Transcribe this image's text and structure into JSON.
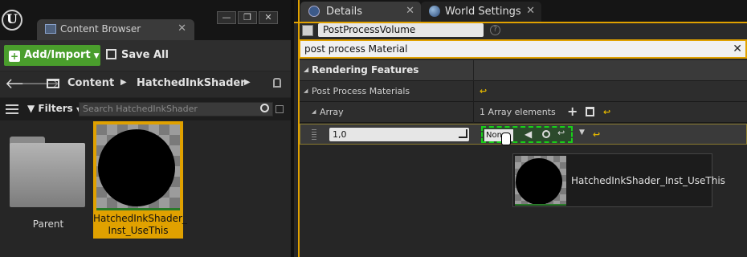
{
  "content_browser": {
    "tab_title": "Content Browser",
    "add_import_label": "Add/Import",
    "save_all_label": "Save All",
    "path": [
      "Content",
      "HatchedInkShader"
    ],
    "filters_label": "Filters",
    "search_placeholder": "Search HatchedInkShader",
    "folder_label": "Parent",
    "asset_label_line1": "HatchedInkShader_",
    "asset_label_line2": "Inst_UseThis",
    "window_buttons": [
      "—",
      "❐",
      "✕"
    ]
  },
  "details": {
    "tabs": [
      {
        "label": "Details",
        "icon": "info-icon",
        "active": true
      },
      {
        "label": "World Settings",
        "icon": "globe-icon",
        "active": false
      }
    ],
    "actor_name": "PostProcessVolume",
    "search_value": "post process Material",
    "category": "Rendering Features",
    "rows": {
      "ppm_label": "Post Process Materials",
      "array_label": "Array",
      "array_count": "1 Array elements",
      "element_weight": "1,0",
      "material_value": "None"
    },
    "drag_asset_label": "HatchedInkShader_Inst_UseThis"
  },
  "colors": {
    "accent_orange": "#e0a100",
    "add_green": "#4a9e2c",
    "drop_target_green": "#18d018"
  }
}
